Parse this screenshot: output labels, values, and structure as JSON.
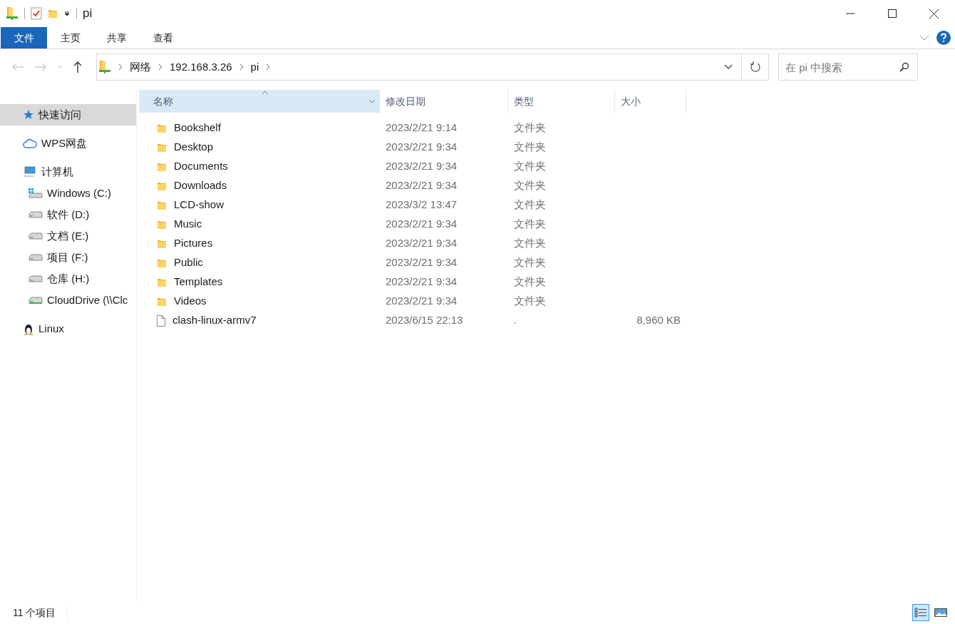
{
  "window": {
    "title": "pi"
  },
  "ribbon_tabs": [
    {
      "label": "文件",
      "selected": true
    },
    {
      "label": "主页",
      "selected": false
    },
    {
      "label": "共享",
      "selected": false
    },
    {
      "label": "查看",
      "selected": false
    }
  ],
  "breadcrumb": [
    "网络",
    "192.168.3.26",
    "pi"
  ],
  "search": {
    "placeholder": "在 pi 中搜索"
  },
  "sidebar": {
    "items": [
      {
        "kind": "star",
        "label": "快速访问",
        "selected": true
      },
      {
        "kind": "cloud",
        "label": "WPS网盘",
        "selected": false
      },
      {
        "kind": "computer",
        "label": "计算机",
        "selected": false,
        "children": [
          {
            "kind": "windows-drive",
            "label": "Windows (C:)",
            "selected": false
          },
          {
            "kind": "drive",
            "label": "软件 (D:)",
            "selected": false
          },
          {
            "kind": "drive",
            "label": "文档 (E:)",
            "selected": false
          },
          {
            "kind": "drive",
            "label": "项目 (F:)",
            "selected": false
          },
          {
            "kind": "drive",
            "label": "仓库 (H:)",
            "selected": false
          },
          {
            "kind": "network-drive",
            "label": "CloudDrive (\\\\Clc",
            "selected": false
          }
        ]
      },
      {
        "kind": "linux",
        "label": "Linux",
        "selected": false
      }
    ]
  },
  "table": {
    "columns": [
      {
        "label": "名称",
        "selected": true
      },
      {
        "label": "修改日期",
        "selected": false
      },
      {
        "label": "类型",
        "selected": false
      },
      {
        "label": "大小",
        "selected": false
      }
    ],
    "rows": [
      {
        "kind": "folder",
        "name": "Bookshelf",
        "date": "2023/2/21 9:14",
        "type": "文件夹"
      },
      {
        "kind": "folder",
        "name": "Desktop",
        "date": "2023/2/21 9:34",
        "type": "文件夹"
      },
      {
        "kind": "folder",
        "name": "Documents",
        "date": "2023/2/21 9:34",
        "type": "文件夹"
      },
      {
        "kind": "folder",
        "name": "Downloads",
        "date": "2023/2/21 9:34",
        "type": "文件夹"
      },
      {
        "kind": "folder",
        "name": "LCD-show",
        "date": "2023/3/2 13:47",
        "type": "文件夹"
      },
      {
        "kind": "folder",
        "name": "Music",
        "date": "2023/2/21 9:34",
        "type": "文件夹"
      },
      {
        "kind": "folder",
        "name": "Pictures",
        "date": "2023/2/21 9:34",
        "type": "文件夹"
      },
      {
        "kind": "folder",
        "name": "Public",
        "date": "2023/2/21 9:34",
        "type": "文件夹"
      },
      {
        "kind": "folder",
        "name": "Templates",
        "date": "2023/2/21 9:34",
        "type": "文件夹"
      },
      {
        "kind": "folder",
        "name": "Videos",
        "date": "2023/2/21 9:34",
        "type": "文件夹"
      },
      {
        "kind": "file",
        "name": "clash-linux-armv7",
        "date": "2023/6/15 22:13",
        "type": ".",
        "size": "8,960 KB"
      }
    ]
  },
  "status_bar": {
    "count": "11 个项目",
    "view_buttons": [
      {
        "kind": "details",
        "selected": true
      },
      {
        "kind": "large-icons",
        "selected": false
      }
    ]
  }
}
